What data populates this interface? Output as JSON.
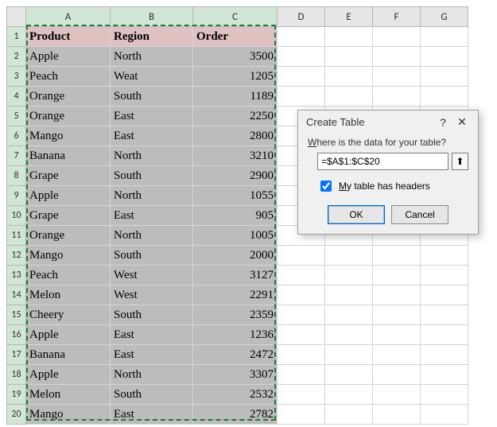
{
  "columns": [
    "A",
    "B",
    "C",
    "D",
    "E",
    "F",
    "G"
  ],
  "headers": {
    "A": "Product",
    "B": "Region",
    "C": "Order"
  },
  "chart_data": {
    "type": "table",
    "title": "Product Orders by Region",
    "columns": [
      "Product",
      "Region",
      "Order"
    ],
    "rows": [
      [
        "Apple",
        "North",
        3500
      ],
      [
        "Peach",
        "Weat",
        1205
      ],
      [
        "Orange",
        "South",
        1189
      ],
      [
        "Orange",
        "East",
        2250
      ],
      [
        "Mango",
        "East",
        2800
      ],
      [
        "Banana",
        "North",
        3210
      ],
      [
        "Grape",
        "South",
        2900
      ],
      [
        "Apple",
        "North",
        1055
      ],
      [
        "Grape",
        "East",
        905
      ],
      [
        "Orange",
        "North",
        1005
      ],
      [
        "Mango",
        "South",
        2000
      ],
      [
        "Peach",
        "West",
        3127
      ],
      [
        "Melon",
        "West",
        2291
      ],
      [
        "Cheery",
        "South",
        2359
      ],
      [
        "Apple",
        "East",
        1236
      ],
      [
        "Banana",
        "East",
        2472
      ],
      [
        "Apple",
        "North",
        3307
      ],
      [
        "Melon",
        "South",
        2532
      ],
      [
        "Mango",
        "East",
        2782
      ]
    ]
  },
  "dialog": {
    "title": "Create Table",
    "prompt_pre": "W",
    "prompt_rest": "here is the data for your table?",
    "range_value": "=$A$1:$C$20",
    "checkbox_checked": true,
    "checkbox_pre": "M",
    "checkbox_rest": "y table has headers",
    "ok": "OK",
    "cancel": "Cancel",
    "help_symbol": "?",
    "close_symbol": "✕",
    "collapse_symbol": "⬆"
  }
}
